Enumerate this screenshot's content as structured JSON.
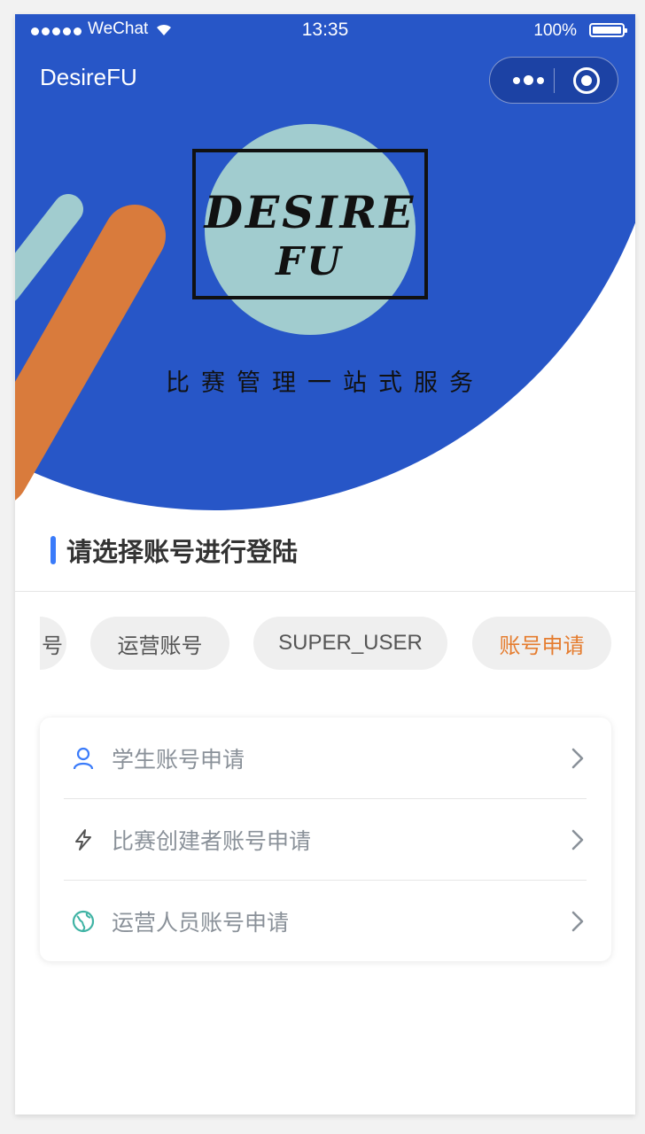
{
  "status_bar": {
    "carrier": "WeChat",
    "time": "13:35",
    "battery": "100%"
  },
  "nav": {
    "title": "DesireFU"
  },
  "hero": {
    "logo_line1": "DESIRE",
    "logo_line2": "FU",
    "slogan": "比赛管理一站式服务"
  },
  "section": {
    "title": "请选择账号进行登陆"
  },
  "tabs": [
    {
      "label": "号"
    },
    {
      "label": "运营账号"
    },
    {
      "label": "SUPER_USER"
    },
    {
      "label": "账号申请",
      "active": true
    }
  ],
  "apply_list": [
    {
      "label": "学生账号申请",
      "icon": "user-icon"
    },
    {
      "label": "比赛创建者账号申请",
      "icon": "lightning-icon"
    },
    {
      "label": "运营人员账号申请",
      "icon": "globe-icon"
    }
  ],
  "colors": {
    "primary_blue": "#2756c7",
    "accent_orange": "#e57c2e",
    "tab_bg": "#efefef",
    "title_bar": "#3a7bfa"
  }
}
